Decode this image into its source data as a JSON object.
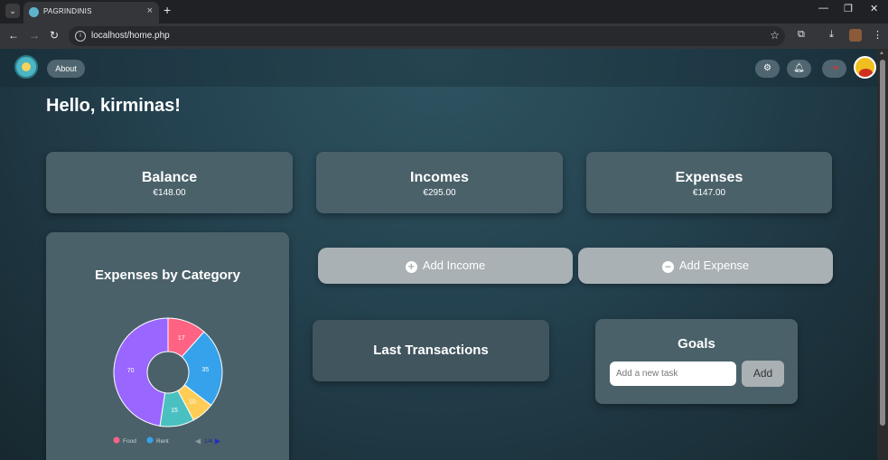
{
  "browser": {
    "tab_title": "PAGRINDINIS",
    "url": "localhost/home.php",
    "new_tab": "+",
    "tab_close": "×"
  },
  "nav": {
    "about_label": "About",
    "icons": [
      "gear-icon",
      "bell-icon",
      "logout-icon"
    ]
  },
  "greeting": "Hello, kirminas!",
  "summary": [
    {
      "title": "Balance",
      "value": "€148.00"
    },
    {
      "title": "Incomes",
      "value": "€295.00"
    },
    {
      "title": "Expenses",
      "value": "€147.00"
    }
  ],
  "actions": {
    "add_income_label": "Add Income",
    "add_expense_label": "Add Expense"
  },
  "expenses_chart": {
    "title": "Expenses by Category",
    "legend_page": "1/4",
    "chart_data": {
      "type": "pie",
      "variant": "doughnut",
      "values": [
        17,
        35,
        10,
        15,
        70
      ],
      "colors": [
        "#ff6384",
        "#36a2eb",
        "#ffcd56",
        "#4bc0c0",
        "#9966ff"
      ],
      "legend": [
        {
          "label": "Food",
          "color": "#ff6384"
        },
        {
          "label": "Rent",
          "color": "#36a2eb"
        }
      ]
    }
  },
  "last_transactions": {
    "title": "Last Transactions"
  },
  "goals": {
    "title": "Goals",
    "input_placeholder": "Add a new task",
    "add_label": "Add"
  }
}
